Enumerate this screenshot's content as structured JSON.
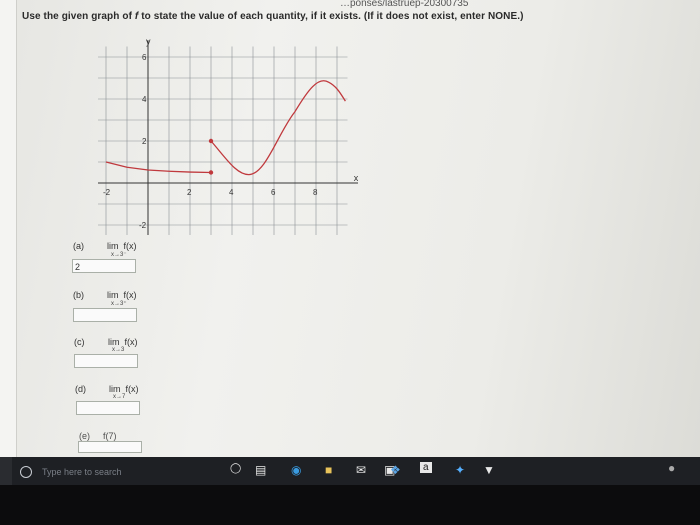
{
  "browser": {
    "url_fragment": "…ponses/lastruep-20300735"
  },
  "question": {
    "text_before": "Use the given graph of ",
    "fname": "f",
    "text_after": " to state the value of each quantity, if it exists. (If it does not exist, enter NONE.)"
  },
  "graph": {
    "y_axis_label": "y",
    "x_axis_label": "x",
    "x_ticks": [
      "-2",
      "2",
      "4",
      "6",
      "8"
    ],
    "y_ticks": [
      "6",
      "4",
      "2",
      "-2"
    ],
    "curve_color": "#c0393d"
  },
  "parts": [
    {
      "letter": "(a)",
      "lim": "lim",
      "fx": "f(x)",
      "approach": "x→3⁻",
      "value": "2"
    },
    {
      "letter": "(b)",
      "lim": "lim",
      "fx": "f(x)",
      "approach": "x→3⁺",
      "value": ""
    },
    {
      "letter": "(c)",
      "lim": "lim",
      "fx": "f(x)",
      "approach": "x→3",
      "value": ""
    },
    {
      "letter": "(d)",
      "lim": "lim",
      "fx": "f(x)",
      "approach": "x→7",
      "value": ""
    },
    {
      "letter": "(e)",
      "lim": "",
      "fx": "f(7)",
      "approach": "",
      "value": ""
    }
  ],
  "taskbar": {
    "search_placeholder": "Type here to search",
    "icons": [
      "microphone-icon",
      "task-view-icon",
      "edge-icon",
      "file-explorer-icon",
      "mail-icon",
      "store-icon",
      "dropbox-icon",
      "a-app-icon",
      "pin-app-icon",
      "chevron-app-icon"
    ]
  }
}
